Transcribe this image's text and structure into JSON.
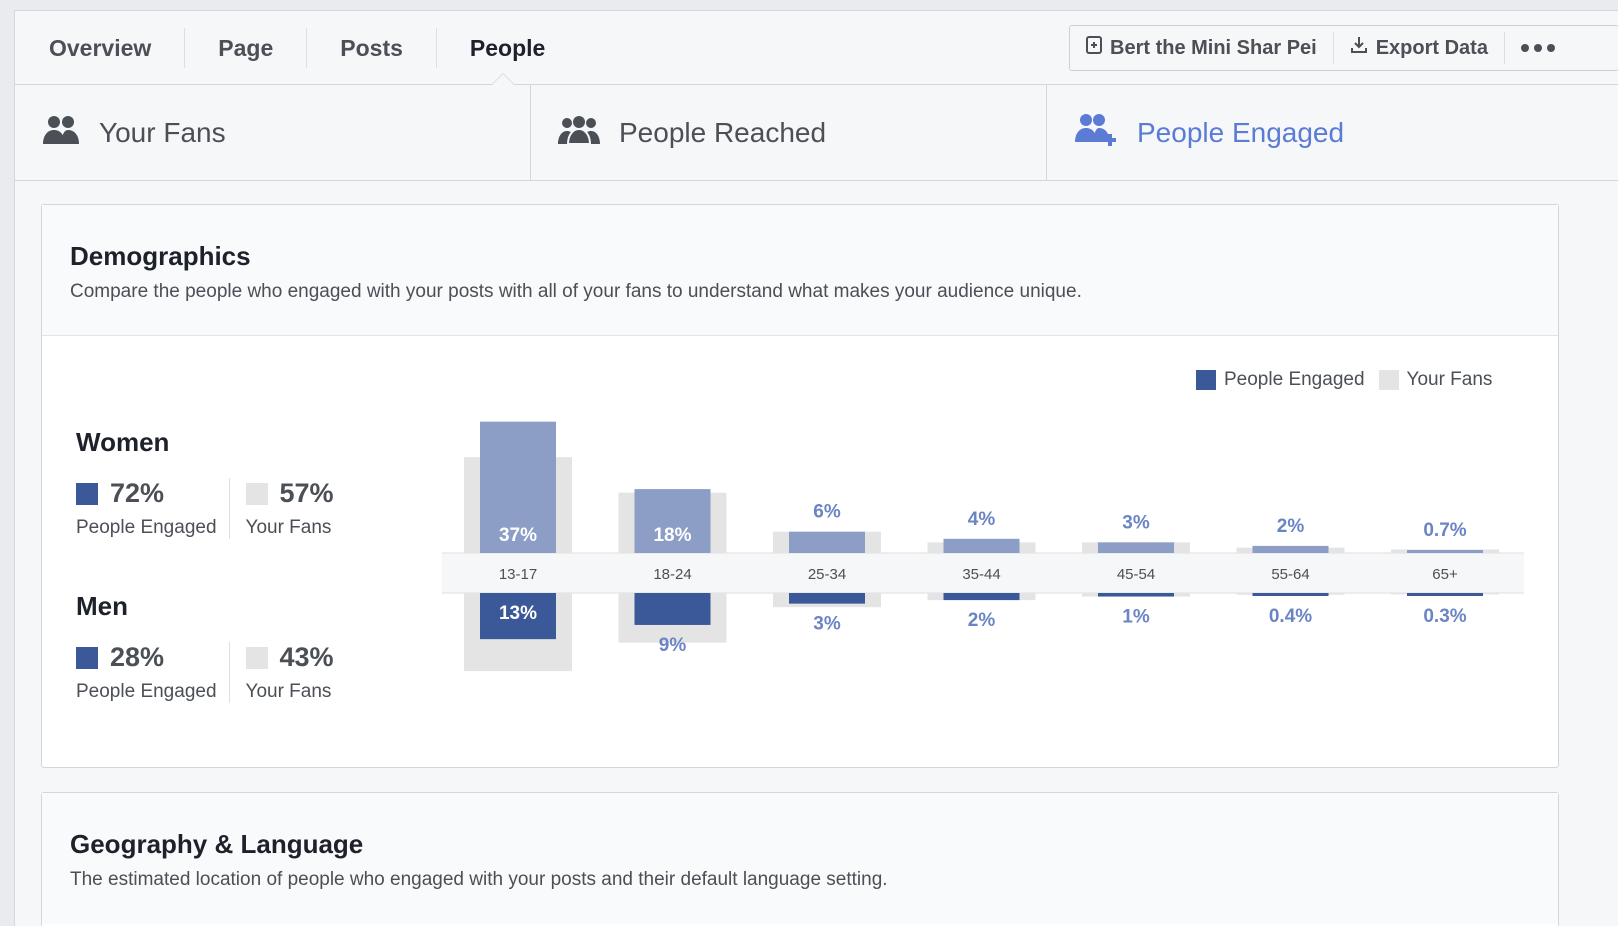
{
  "nav": {
    "tabs": [
      "Overview",
      "Page",
      "Posts",
      "People"
    ],
    "active": "People"
  },
  "actions": {
    "page_name": "Bert the Mini Shar Pei",
    "export": "Export Data"
  },
  "metric_tabs": [
    {
      "label": "Your Fans",
      "icon": "people-icon"
    },
    {
      "label": "People Reached",
      "icon": "group-icon"
    },
    {
      "label": "People Engaged",
      "icon": "people-add-icon"
    }
  ],
  "demographics": {
    "title": "Demographics",
    "subtitle": "Compare the people who engaged with your posts with all of your fans to understand what makes your audience unique.",
    "legend": [
      "People Engaged",
      "Your Fans"
    ],
    "women": {
      "title": "Women",
      "engaged": "72%",
      "fans": "57%",
      "engaged_label": "People Engaged",
      "fans_label": "Your Fans"
    },
    "men": {
      "title": "Men",
      "engaged": "28%",
      "fans": "43%",
      "engaged_label": "People Engaged",
      "fans_label": "Your Fans"
    }
  },
  "geography": {
    "title": "Geography & Language",
    "subtitle": "The estimated location of people who engaged with your posts and their default language setting."
  },
  "colors": {
    "engaged_women": "#8c9dc6",
    "engaged_men": "#3b5998",
    "fans": "#e4e4e4",
    "label_blue": "#6a84c4",
    "active_tab": "#5b7bd5"
  },
  "chart_data": {
    "type": "bar",
    "categories": [
      "13-17",
      "18-24",
      "25-34",
      "35-44",
      "45-54",
      "55-64",
      "65+"
    ],
    "series": [
      {
        "name": "People Engaged",
        "group": "Women",
        "values": [
          37,
          18,
          6,
          4,
          3,
          2,
          0.7
        ],
        "labels": [
          "37%",
          "18%",
          "6%",
          "4%",
          "3%",
          "2%",
          "0.7%"
        ]
      },
      {
        "name": "Your Fans",
        "group": "Women",
        "values": [
          27,
          17,
          6,
          3,
          3,
          1.5,
          1
        ]
      },
      {
        "name": "People Engaged",
        "group": "Men",
        "values": [
          13,
          9,
          3,
          2,
          1,
          0.4,
          0.3
        ],
        "labels": [
          "13%",
          "9%",
          "3%",
          "2%",
          "1%",
          "0.4%",
          "0.3%"
        ]
      },
      {
        "name": "Your Fans",
        "group": "Men",
        "values": [
          22,
          14,
          4,
          2,
          1,
          0.5,
          0.4
        ]
      }
    ],
    "legend": "top-right",
    "grid": false
  }
}
